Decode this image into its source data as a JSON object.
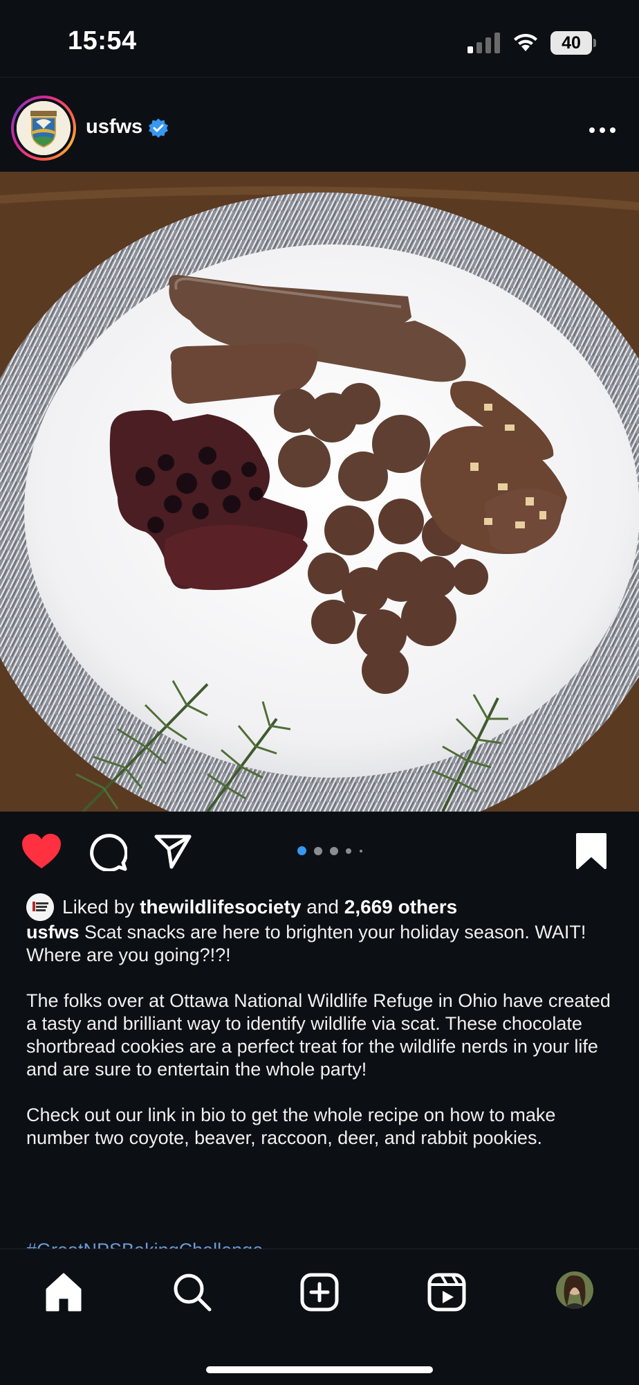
{
  "status_bar": {
    "time": "15:54",
    "battery": "40"
  },
  "post": {
    "username": "usfws",
    "verified": true,
    "carousel_count": 5,
    "carousel_active_index": 0,
    "liked": true,
    "likes": {
      "prefix": "Liked by",
      "liker": "thewildlifesociety",
      "conjunction": "and",
      "others": "2,669 others"
    },
    "caption": {
      "username": "usfws",
      "paragraphs": [
        "Scat snacks are here to brighten your holiday season. WAIT! Where are you going?!?!",
        "The folks over at Ottawa National Wildlife Refuge in Ohio have created a tasty and brilliant way to identify wildlife via scat. These chocolate shortbread cookies are a perfect treat for the wildlife nerds in your life and are sure to entertain the whole party!",
        "Check out our link in bio to get the whole recipe on how to make number two coyote, beaver, raccoon, deer, and rabbit pookies."
      ],
      "hashtag_partial": "#GreatNPSBakingChallenge"
    }
  },
  "icons": {
    "header": [
      "verified-badge-icon",
      "more-options-icon"
    ],
    "actions": [
      "heart-icon",
      "comment-icon",
      "share-icon",
      "bookmark-icon"
    ],
    "tabs": [
      "home-icon",
      "search-icon",
      "create-icon",
      "reels-icon",
      "profile-avatar"
    ]
  },
  "colors": {
    "background": "#0c0f14",
    "like_red": "#ff3040",
    "verified_blue": "#3897f0",
    "active_dot": "#3897f0",
    "hashtag": "#6b9bd6"
  }
}
